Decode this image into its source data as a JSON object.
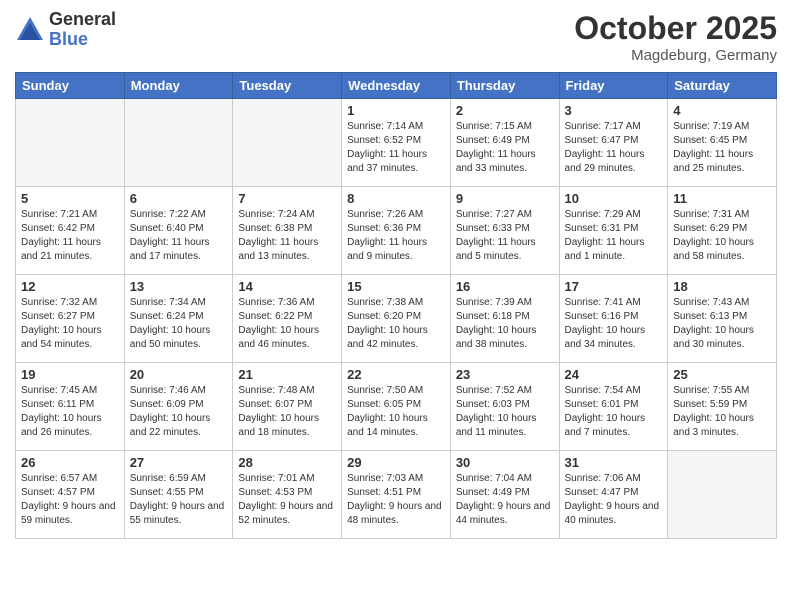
{
  "header": {
    "logo_general": "General",
    "logo_blue": "Blue",
    "month_title": "October 2025",
    "location": "Magdeburg, Germany"
  },
  "days_of_week": [
    "Sunday",
    "Monday",
    "Tuesday",
    "Wednesday",
    "Thursday",
    "Friday",
    "Saturday"
  ],
  "weeks": [
    [
      {
        "day": "",
        "info": ""
      },
      {
        "day": "",
        "info": ""
      },
      {
        "day": "",
        "info": ""
      },
      {
        "day": "1",
        "info": "Sunrise: 7:14 AM\nSunset: 6:52 PM\nDaylight: 11 hours\nand 37 minutes."
      },
      {
        "day": "2",
        "info": "Sunrise: 7:15 AM\nSunset: 6:49 PM\nDaylight: 11 hours\nand 33 minutes."
      },
      {
        "day": "3",
        "info": "Sunrise: 7:17 AM\nSunset: 6:47 PM\nDaylight: 11 hours\nand 29 minutes."
      },
      {
        "day": "4",
        "info": "Sunrise: 7:19 AM\nSunset: 6:45 PM\nDaylight: 11 hours\nand 25 minutes."
      }
    ],
    [
      {
        "day": "5",
        "info": "Sunrise: 7:21 AM\nSunset: 6:42 PM\nDaylight: 11 hours\nand 21 minutes."
      },
      {
        "day": "6",
        "info": "Sunrise: 7:22 AM\nSunset: 6:40 PM\nDaylight: 11 hours\nand 17 minutes."
      },
      {
        "day": "7",
        "info": "Sunrise: 7:24 AM\nSunset: 6:38 PM\nDaylight: 11 hours\nand 13 minutes."
      },
      {
        "day": "8",
        "info": "Sunrise: 7:26 AM\nSunset: 6:36 PM\nDaylight: 11 hours\nand 9 minutes."
      },
      {
        "day": "9",
        "info": "Sunrise: 7:27 AM\nSunset: 6:33 PM\nDaylight: 11 hours\nand 5 minutes."
      },
      {
        "day": "10",
        "info": "Sunrise: 7:29 AM\nSunset: 6:31 PM\nDaylight: 11 hours\nand 1 minute."
      },
      {
        "day": "11",
        "info": "Sunrise: 7:31 AM\nSunset: 6:29 PM\nDaylight: 10 hours\nand 58 minutes."
      }
    ],
    [
      {
        "day": "12",
        "info": "Sunrise: 7:32 AM\nSunset: 6:27 PM\nDaylight: 10 hours\nand 54 minutes."
      },
      {
        "day": "13",
        "info": "Sunrise: 7:34 AM\nSunset: 6:24 PM\nDaylight: 10 hours\nand 50 minutes."
      },
      {
        "day": "14",
        "info": "Sunrise: 7:36 AM\nSunset: 6:22 PM\nDaylight: 10 hours\nand 46 minutes."
      },
      {
        "day": "15",
        "info": "Sunrise: 7:38 AM\nSunset: 6:20 PM\nDaylight: 10 hours\nand 42 minutes."
      },
      {
        "day": "16",
        "info": "Sunrise: 7:39 AM\nSunset: 6:18 PM\nDaylight: 10 hours\nand 38 minutes."
      },
      {
        "day": "17",
        "info": "Sunrise: 7:41 AM\nSunset: 6:16 PM\nDaylight: 10 hours\nand 34 minutes."
      },
      {
        "day": "18",
        "info": "Sunrise: 7:43 AM\nSunset: 6:13 PM\nDaylight: 10 hours\nand 30 minutes."
      }
    ],
    [
      {
        "day": "19",
        "info": "Sunrise: 7:45 AM\nSunset: 6:11 PM\nDaylight: 10 hours\nand 26 minutes."
      },
      {
        "day": "20",
        "info": "Sunrise: 7:46 AM\nSunset: 6:09 PM\nDaylight: 10 hours\nand 22 minutes."
      },
      {
        "day": "21",
        "info": "Sunrise: 7:48 AM\nSunset: 6:07 PM\nDaylight: 10 hours\nand 18 minutes."
      },
      {
        "day": "22",
        "info": "Sunrise: 7:50 AM\nSunset: 6:05 PM\nDaylight: 10 hours\nand 14 minutes."
      },
      {
        "day": "23",
        "info": "Sunrise: 7:52 AM\nSunset: 6:03 PM\nDaylight: 10 hours\nand 11 minutes."
      },
      {
        "day": "24",
        "info": "Sunrise: 7:54 AM\nSunset: 6:01 PM\nDaylight: 10 hours\nand 7 minutes."
      },
      {
        "day": "25",
        "info": "Sunrise: 7:55 AM\nSunset: 5:59 PM\nDaylight: 10 hours\nand 3 minutes."
      }
    ],
    [
      {
        "day": "26",
        "info": "Sunrise: 6:57 AM\nSunset: 4:57 PM\nDaylight: 9 hours\nand 59 minutes."
      },
      {
        "day": "27",
        "info": "Sunrise: 6:59 AM\nSunset: 4:55 PM\nDaylight: 9 hours\nand 55 minutes."
      },
      {
        "day": "28",
        "info": "Sunrise: 7:01 AM\nSunset: 4:53 PM\nDaylight: 9 hours\nand 52 minutes."
      },
      {
        "day": "29",
        "info": "Sunrise: 7:03 AM\nSunset: 4:51 PM\nDaylight: 9 hours\nand 48 minutes."
      },
      {
        "day": "30",
        "info": "Sunrise: 7:04 AM\nSunset: 4:49 PM\nDaylight: 9 hours\nand 44 minutes."
      },
      {
        "day": "31",
        "info": "Sunrise: 7:06 AM\nSunset: 4:47 PM\nDaylight: 9 hours\nand 40 minutes."
      },
      {
        "day": "",
        "info": ""
      }
    ]
  ]
}
